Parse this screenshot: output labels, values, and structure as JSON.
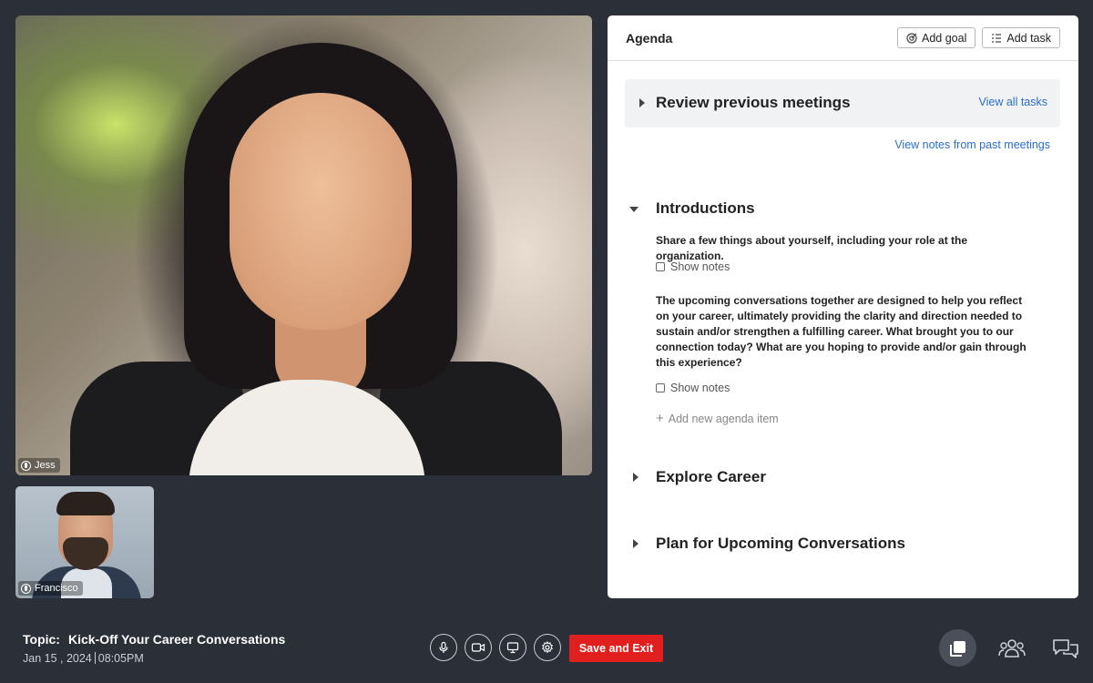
{
  "videos": {
    "main": {
      "name": "Jess"
    },
    "thumb": {
      "name": "Francisco"
    }
  },
  "agenda": {
    "title": "Agenda",
    "add_goal": "Add goal",
    "add_task": "Add task",
    "sections": {
      "review": {
        "title": "Review previous meetings",
        "view_all": "View all tasks",
        "view_notes": "View notes from past meetings"
      },
      "intro": {
        "title": "Introductions",
        "item1": "Share a few things about yourself, including your role at the organization.",
        "item2": "The upcoming conversations together are designed to help you reflect on your career, ultimately providing the clarity and direction needed to sustain and/or strengthen a fulfilling career. What brought you to our connection today? What are you hoping to provide and/or gain through this experience?",
        "show_notes": "Show notes",
        "add_item": "Add new agenda item"
      },
      "explore": {
        "title": "Explore Career"
      },
      "plan": {
        "title": "Plan for Upcoming Conversations"
      }
    }
  },
  "footer": {
    "topic_label": "Topic:",
    "topic": "Kick-Off Your Career Conversations",
    "date": "Jan 15 , 2024",
    "time": "08:05PM",
    "save_exit": "Save and Exit"
  },
  "icons": {
    "mic": "microphone-icon",
    "video": "video-camera-icon",
    "screen": "screen-share-icon",
    "settings": "gear-icon",
    "notes": "notes-stack-icon",
    "people": "participants-icon",
    "chat": "chat-icon"
  },
  "colors": {
    "background": "#2b2f38",
    "accent_red": "#e21f1f",
    "link_blue": "#2a6fc9"
  }
}
